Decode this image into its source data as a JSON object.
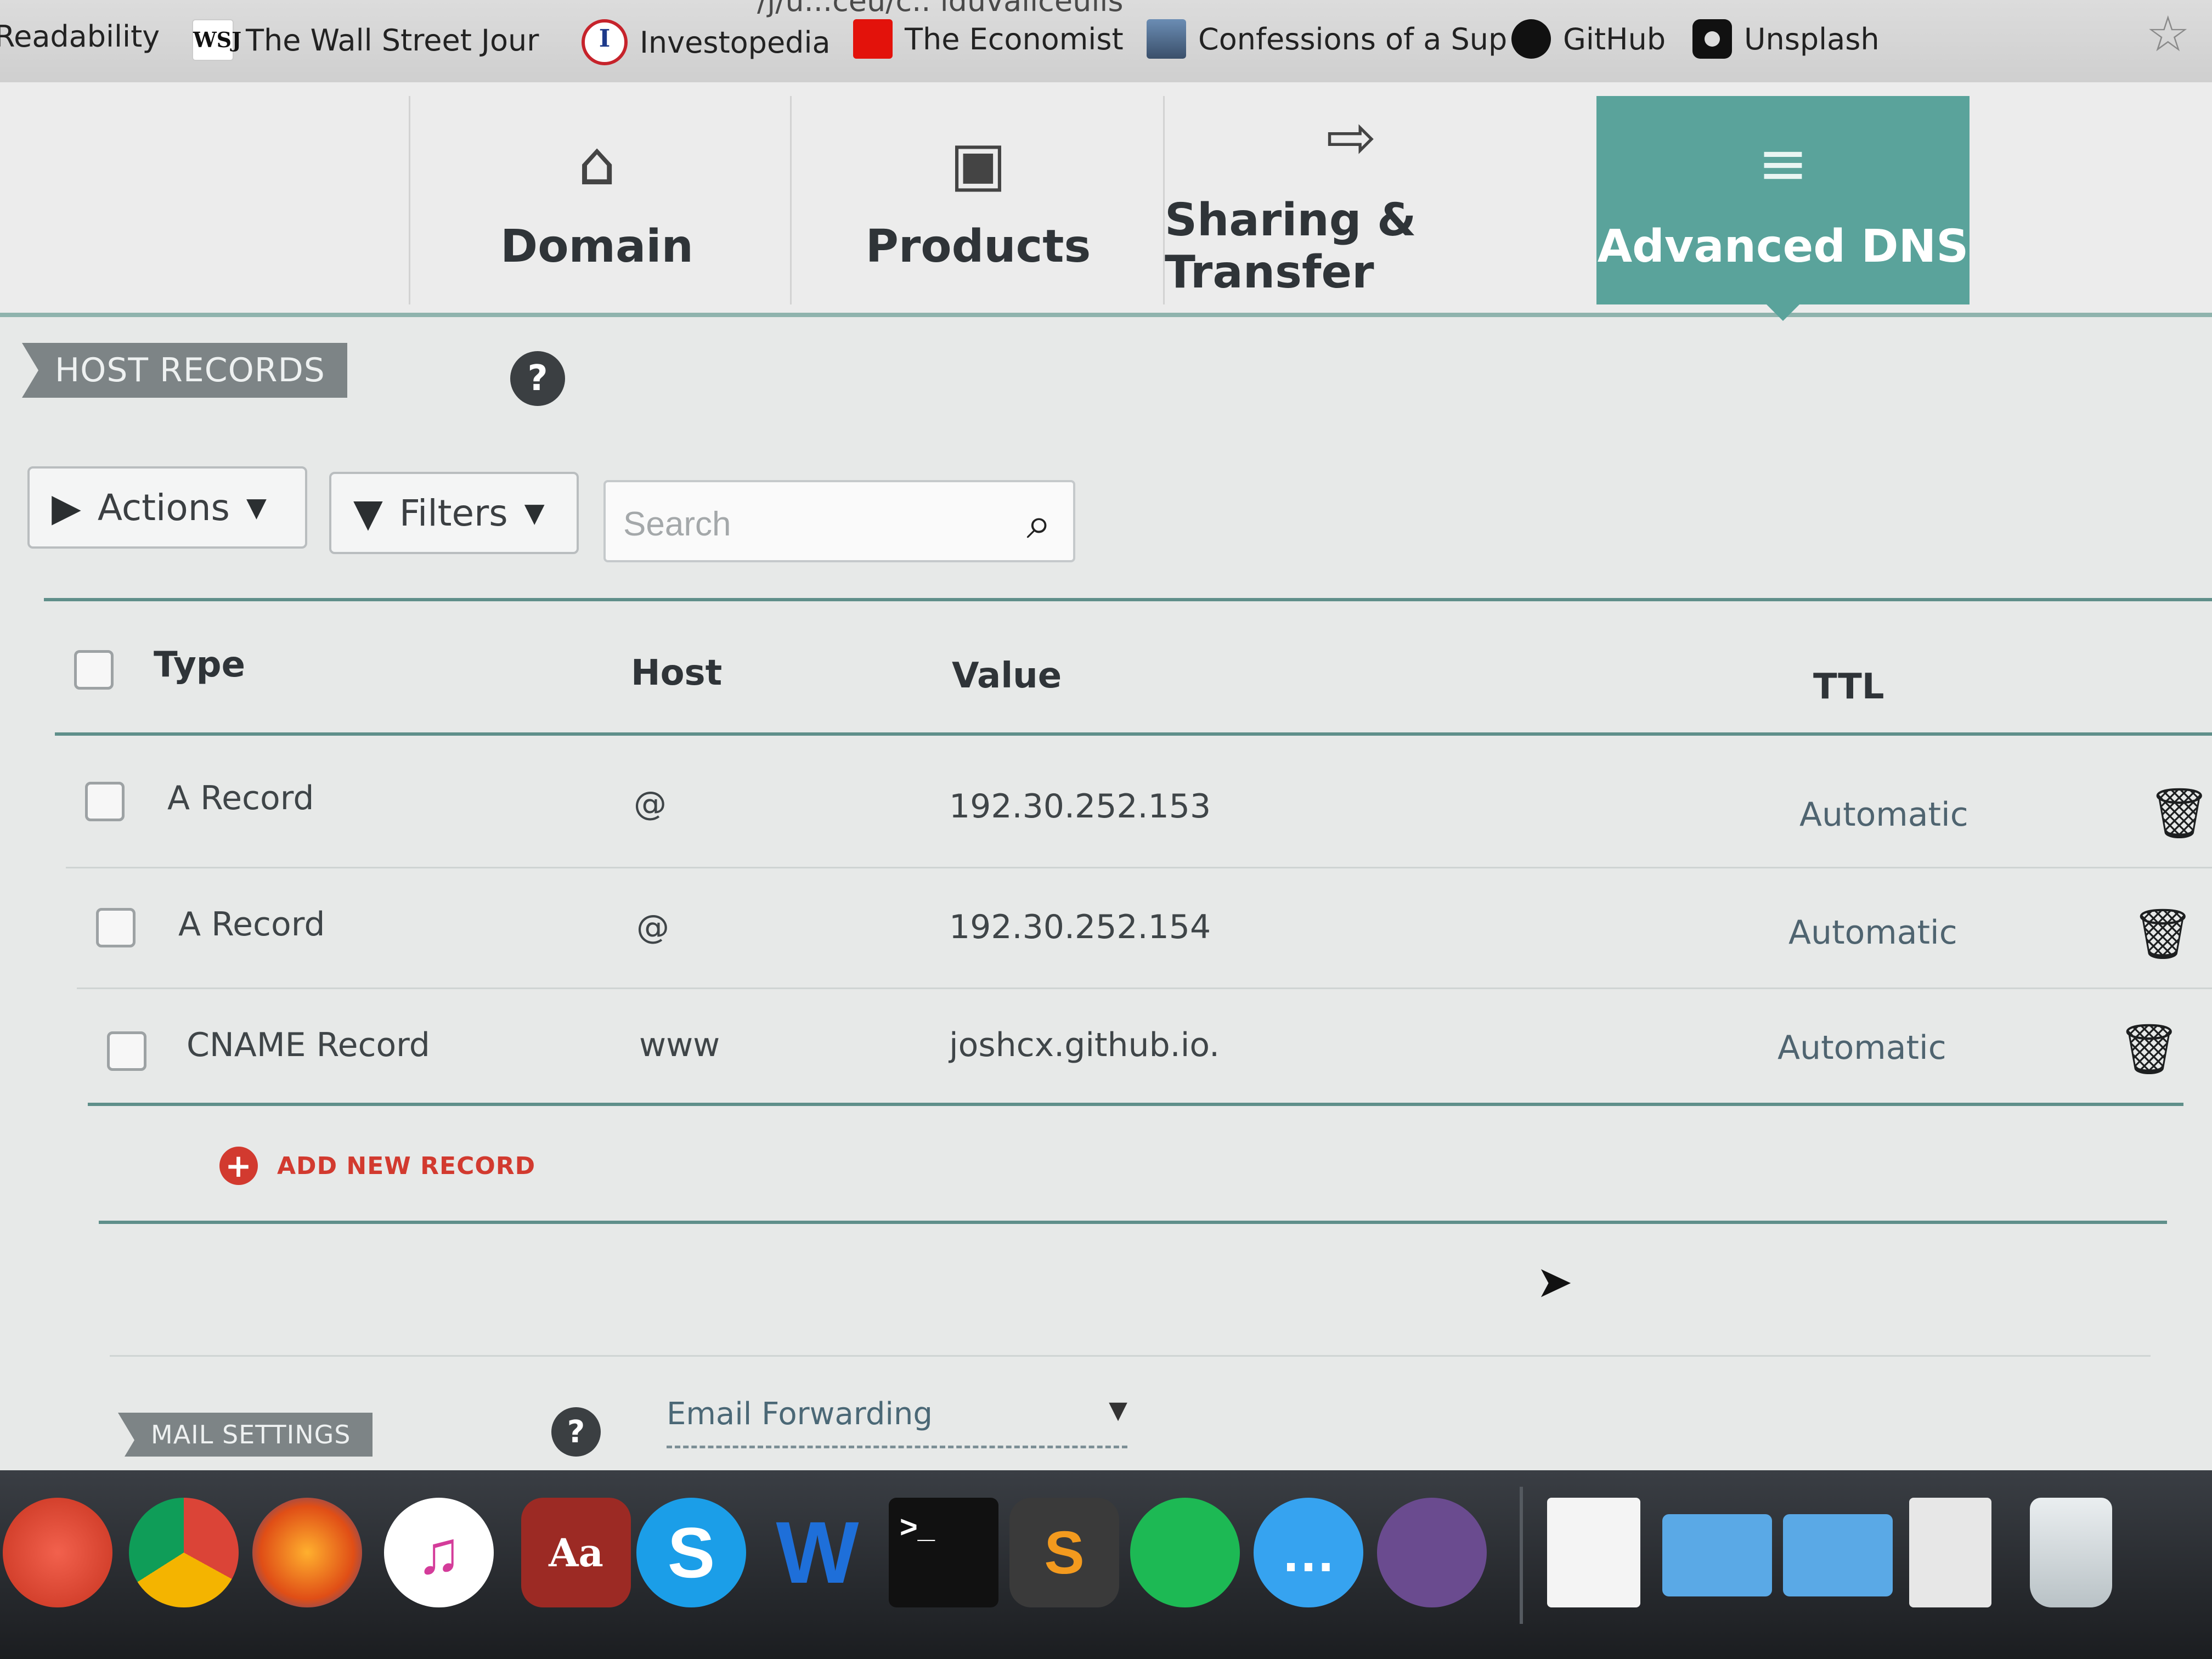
{
  "browser": {
    "url_fragment": "/j/u...ceu/c.. lduvaliceulls",
    "bookmarks": [
      {
        "label": "Readability",
        "icon": "readability-icon"
      },
      {
        "label": "The Wall Street Jour",
        "icon": "wsj-icon",
        "icon_text": "WSJ"
      },
      {
        "label": "Investopedia",
        "icon": "investopedia-icon",
        "icon_text": "I"
      },
      {
        "label": "The Economist",
        "icon": "economist-icon"
      },
      {
        "label": "Confessions of a Sup",
        "icon": "avatar-icon"
      },
      {
        "label": "GitHub",
        "icon": "github-icon"
      },
      {
        "label": "Unsplash",
        "icon": "camera-icon"
      }
    ],
    "more_bookmarks": "»",
    "star_icon": "☆"
  },
  "tabs": [
    {
      "label": "Domain",
      "icon": "home-icon",
      "glyph": "⌂",
      "active": false
    },
    {
      "label": "Products",
      "icon": "box-icon",
      "glyph": "▣",
      "active": false
    },
    {
      "label": "Sharing & Transfer",
      "icon": "transfer-icon",
      "glyph": "⇨",
      "active": false
    },
    {
      "label": "Advanced DNS",
      "icon": "server-icon",
      "glyph": "≡",
      "active": true
    }
  ],
  "host_records": {
    "label": "HOST RECORDS",
    "help": "?",
    "actions_label": "Actions",
    "filters_label": "Filters",
    "search_placeholder": "Search",
    "columns": {
      "type": "Type",
      "host": "Host",
      "value": "Value",
      "ttl": "TTL"
    },
    "rows": [
      {
        "type": "A Record",
        "host": "@",
        "value": "192.30.252.153",
        "ttl": "Automatic"
      },
      {
        "type": "A Record",
        "host": "@",
        "value": "192.30.252.154",
        "ttl": "Automatic"
      },
      {
        "type": "CNAME Record",
        "host": "www",
        "value": "joshcx.github.io.",
        "ttl": "Automatic"
      }
    ],
    "add_new": "ADD NEW RECORD"
  },
  "mail_settings": {
    "label": "MAIL SETTINGS",
    "help": "?",
    "selected": "Email Forwarding"
  },
  "dock": [
    {
      "name": "dock-sunrise-icon",
      "text": ""
    },
    {
      "name": "dock-chrome-icon",
      "text": ""
    },
    {
      "name": "dock-firefox-icon",
      "text": ""
    },
    {
      "name": "dock-itunes-icon",
      "text": "♫"
    },
    {
      "name": "dock-dictionary-icon",
      "text": "Aa"
    },
    {
      "name": "dock-skype-icon",
      "text": "S"
    },
    {
      "name": "dock-word-icon",
      "text": "W"
    },
    {
      "name": "dock-terminal-icon",
      "text": ">_"
    },
    {
      "name": "dock-sublime-icon",
      "text": "S"
    },
    {
      "name": "dock-spotify-icon",
      "text": ""
    },
    {
      "name": "dock-messages-icon",
      "text": "…"
    },
    {
      "name": "dock-github-icon",
      "text": ""
    },
    {
      "name": "dock-document-icon",
      "text": ""
    },
    {
      "name": "dock-applications-folder-icon",
      "text": ""
    },
    {
      "name": "dock-documents-folder-icon",
      "text": ""
    },
    {
      "name": "dock-file-icon",
      "text": ""
    },
    {
      "name": "dock-trash-icon",
      "text": ""
    }
  ],
  "colors": {
    "accent_teal": "#5aa39b",
    "add_red": "#d23a2f",
    "label_gray": "#7d8486"
  }
}
